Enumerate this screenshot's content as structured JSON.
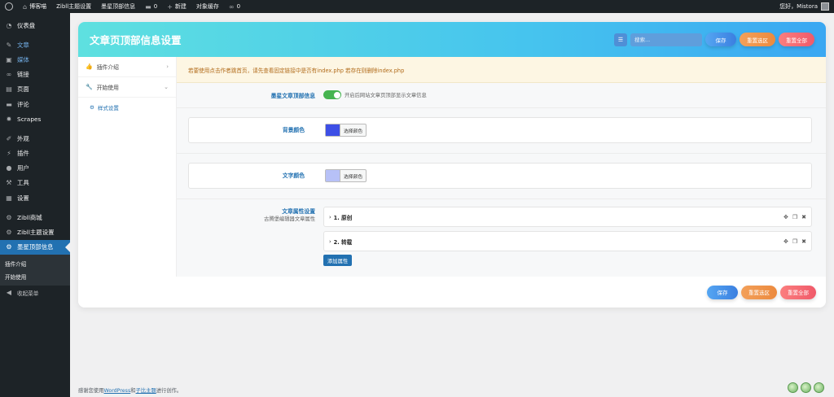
{
  "adminbar": {
    "site_name": "博客喵",
    "theme_settings": "Zibll主题设置",
    "plugin_name": "墨星顶部信息",
    "comments_count": "0",
    "new_label": "新建",
    "cache_label": "对象缓存",
    "links_count": "0",
    "greeting": "您好，Mistora"
  },
  "sidebar": {
    "items": [
      {
        "icon": "dashboard-icon",
        "label": "仪表盘"
      },
      {
        "icon": "pin-icon",
        "label": "文章"
      },
      {
        "icon": "media-icon",
        "label": "媒体"
      },
      {
        "icon": "link-icon",
        "label": "链接"
      },
      {
        "icon": "page-icon",
        "label": "页面"
      },
      {
        "icon": "comment-icon",
        "label": "评论"
      },
      {
        "icon": "scrapes-icon",
        "label": "Scrapes"
      },
      {
        "icon": "appearance-icon",
        "label": "外观"
      },
      {
        "icon": "plugins-icon",
        "label": "插件"
      },
      {
        "icon": "users-icon",
        "label": "用户"
      },
      {
        "icon": "tools-icon",
        "label": "工具"
      },
      {
        "icon": "settings-icon",
        "label": "设置"
      },
      {
        "icon": "shop-icon",
        "label": "Zibll商城"
      },
      {
        "icon": "gear-icon",
        "label": "Zibll主题设置"
      },
      {
        "icon": "gear-icon",
        "label": "墨星顶部信息"
      }
    ],
    "submenu": [
      "插件介绍",
      "开始使用"
    ],
    "collapse_label": "收起菜单"
  },
  "panel": {
    "title": "文章页顶部信息设置",
    "search_placeholder": "搜索...",
    "save_label": "保存",
    "reset_section_label": "重置选区",
    "reset_all_label": "重置全部"
  },
  "nav": {
    "intro_label": "插件介绍",
    "start_label": "开始使用",
    "style_label": "样式设置"
  },
  "content": {
    "notice": "若要使用点击作者跳首页，请先查看固定链接中是否有index.php 若存在则删除index.php",
    "toggle_label": "墨星文章顶部信息",
    "toggle_desc": "开启后网站文章页顶部显示文章信息",
    "toggle_on": true,
    "bg_color_label": "背景颜色",
    "bg_color_button": "选择颜色",
    "text_color_label": "文字颜色",
    "text_color_button": "选择颜色",
    "attr_label": "文章属性设置",
    "attr_desc": "古腾堡编辑器文章属性",
    "groups": [
      {
        "title": "1. 原创"
      },
      {
        "title": "2. 转载"
      }
    ],
    "add_button": "添加属性"
  },
  "colors": {
    "bg_color": "#3d4fe6",
    "text_color": "#b7c1f7",
    "accent": "#2271b1"
  },
  "footer": {
    "thanks_prefix": "感谢您使用",
    "wordpress_link": "WordPress",
    "and": "和",
    "theme_link": "子比主题",
    "suffix": "进行创作。"
  }
}
